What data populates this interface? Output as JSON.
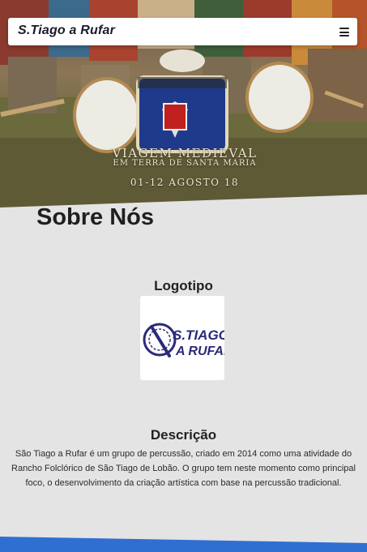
{
  "navbar": {
    "brand": "S.Tiago a Rufar",
    "menu_icon": "hamburger-menu-icon"
  },
  "hero": {
    "caption_line_1": "VIAGEM MEDIEVAL",
    "caption_line_2": "EM TERRA DE SANTA MARIA",
    "caption_line_3": "01-12 AGOSTO 18"
  },
  "main": {
    "section_title": "Sobre Nós",
    "logo_heading": "Logotipo",
    "logo": {
      "text_line_1": "S.TIAGO",
      "text_line_2": "A RUFAR"
    },
    "description_heading": "Descrição",
    "description_text": "São Tiago a Rufar é um grupo de percussão, criado em 2014 como uma atividade do Rancho Folclórico de São Tiago de Lobão. O grupo tem neste momento como principal foco, o desenvolvimento da criação artística com base na percussão tradicional."
  },
  "colors": {
    "page_background": "#e4e4e5",
    "logo_blue": "#2b2a7a",
    "bottom_stripe": "#2f6fd1"
  }
}
